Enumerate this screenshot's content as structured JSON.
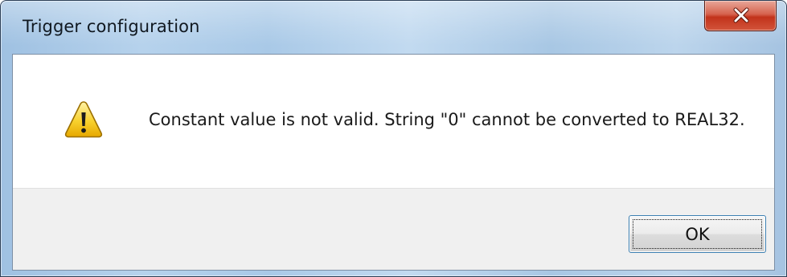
{
  "window": {
    "title": "Trigger configuration",
    "close_icon": "close-icon"
  },
  "dialog": {
    "icon": "warning-icon",
    "message": "Constant value is not valid. String \"0\" cannot be converted to REAL32."
  },
  "buttons": {
    "ok_label": "OK"
  },
  "colors": {
    "close_button_red": "#c2331b",
    "frame_blue": "#a9c9e7",
    "button_area": "#f0f0f0"
  }
}
